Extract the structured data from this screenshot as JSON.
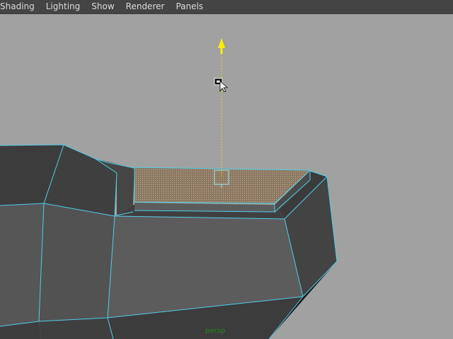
{
  "menubar": {
    "items": [
      {
        "label": "Shading"
      },
      {
        "label": "Lighting"
      },
      {
        "label": "Show"
      },
      {
        "label": "Renderer"
      },
      {
        "label": "Panels"
      }
    ]
  },
  "viewport": {
    "camera_label": "persp",
    "background_color": "#a1a1a1",
    "wireframe_color": "#4fd0e8",
    "manipulator_color": "#ffee00",
    "selected_face_color": "#8a7560"
  }
}
